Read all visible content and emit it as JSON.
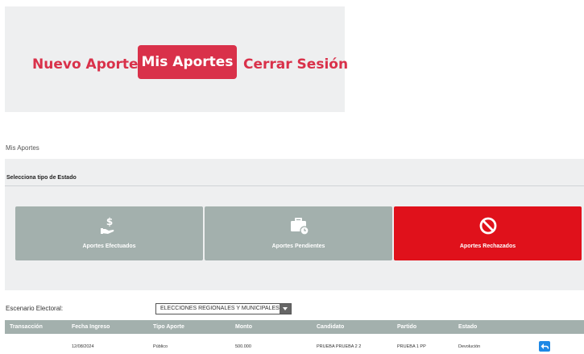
{
  "nav": {
    "items": [
      {
        "label": "Nuevo Aporte"
      },
      {
        "label": "Mis Aportes"
      },
      {
        "label": "Cerrar Sesión"
      }
    ],
    "accent_color": "#d9314a"
  },
  "breadcrumb": "Mis Aportes",
  "estado_panel": {
    "title": "Selecciona tipo de Estado",
    "cards": [
      {
        "label": "Aportes Efectuados",
        "icon": "hand-dollar-icon",
        "color": "#a3b0ad"
      },
      {
        "label": "Aportes Pendientes",
        "icon": "briefcase-clock-icon",
        "color": "#a3b0ad"
      },
      {
        "label": "Aportes Rechazados",
        "icon": "ban-icon",
        "color": "#e0111b"
      }
    ]
  },
  "escenario": {
    "label": "Escenario Electoral:",
    "selected": "ELECCIONES REGIONALES Y MUNICIPALES"
  },
  "table": {
    "headers": [
      "Transacción",
      "Fecha Ingreso",
      "Tipo Aporte",
      "Monto",
      "Candidato",
      "Partido",
      "Estado"
    ],
    "rows": [
      {
        "transaccion": "",
        "fecha": "12/08/2024",
        "tipo": "Público",
        "monto": "500.000",
        "candidato": "PRUEBA PRUEBA 2 2",
        "partido": "PRUEBA 1 PP",
        "estado": "Devolución",
        "action_icon": "reply-icon"
      }
    ]
  }
}
